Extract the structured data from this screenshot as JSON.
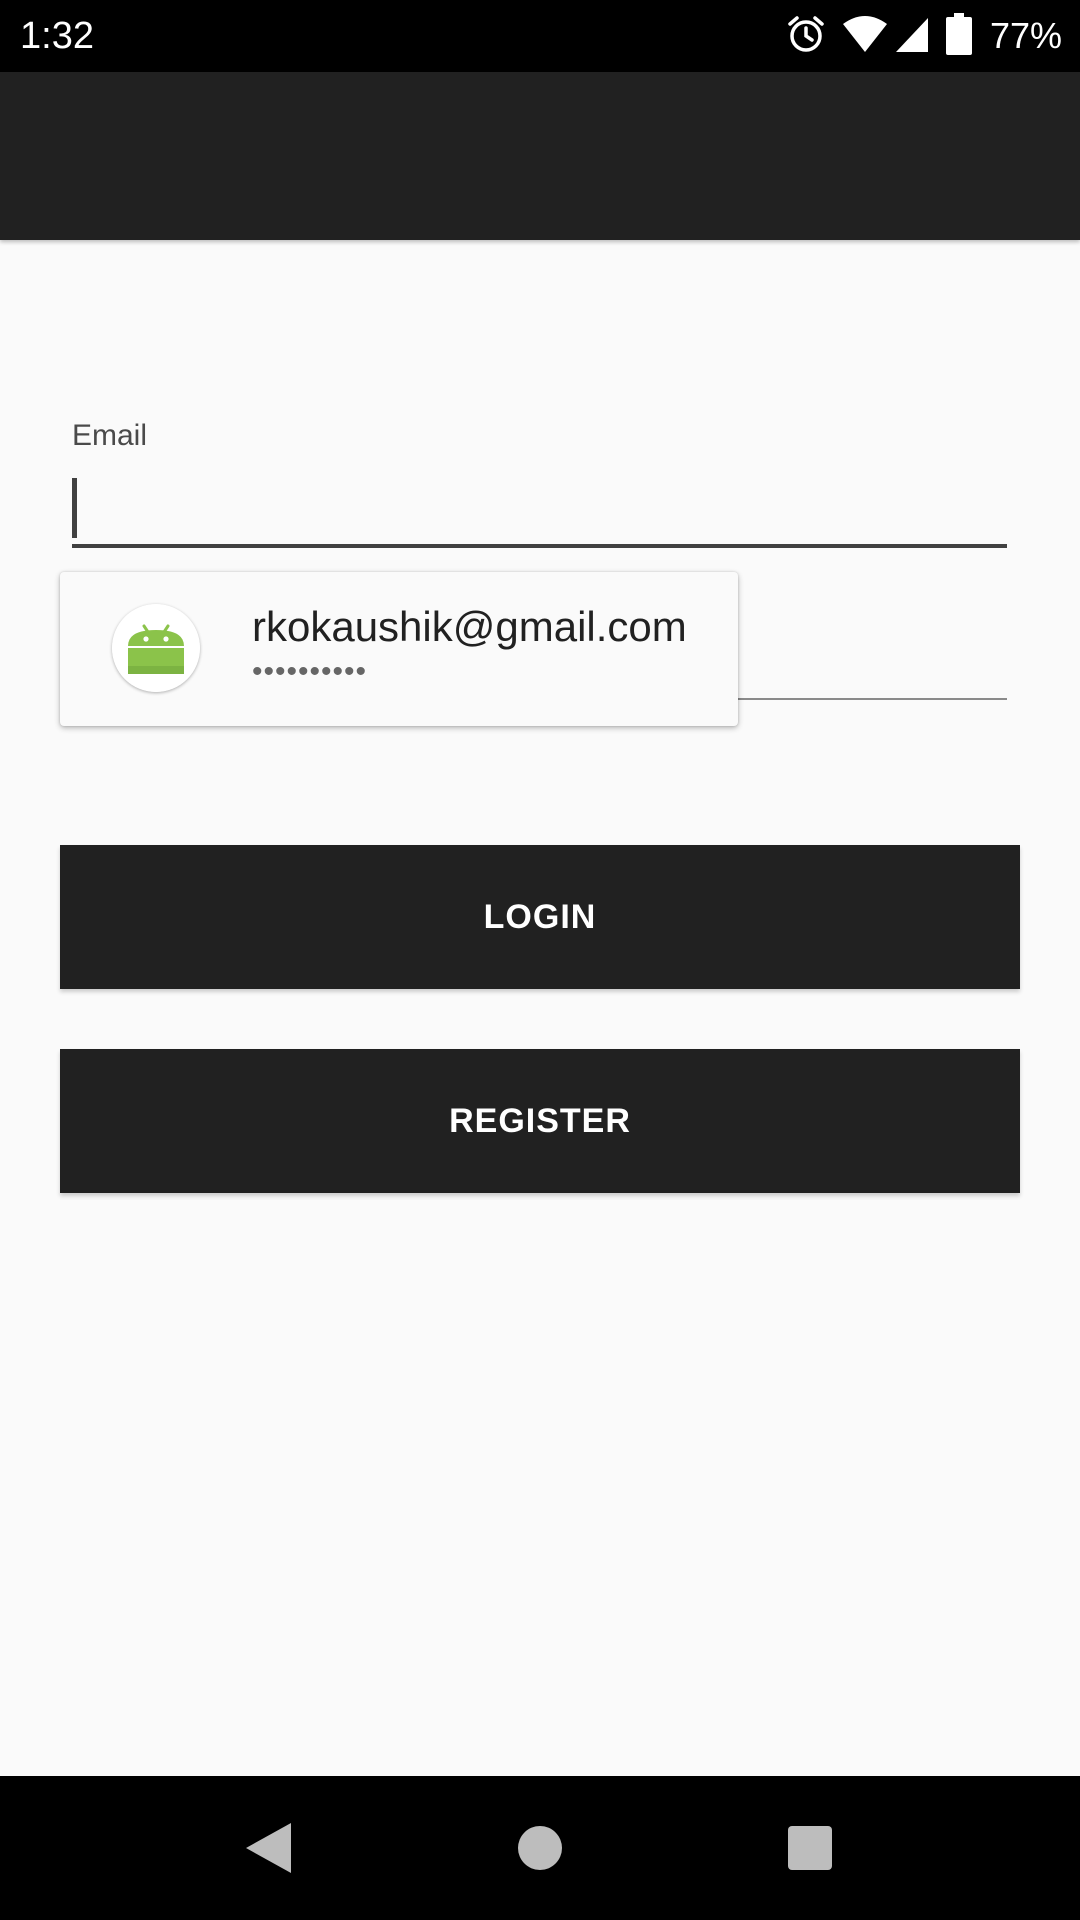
{
  "status_bar": {
    "time": "1:32",
    "battery_percent": "77%",
    "icons": [
      "alarm-icon",
      "wifi-icon",
      "cell-signal-icon",
      "battery-icon"
    ]
  },
  "app_bar": {
    "color": "#212121"
  },
  "login_form": {
    "email_label": "Email",
    "email_value": "",
    "password_value": ""
  },
  "autofill": {
    "account_email": "rkokaushik@gmail.com",
    "masked_password": "••••••••••",
    "app_icon": "android-icon"
  },
  "buttons": {
    "login": "LOGIN",
    "register": "REGISTER"
  },
  "nav_bar": {
    "icons": [
      "back-icon",
      "home-icon",
      "recents-icon"
    ]
  },
  "colors": {
    "primary_dark": "#212121",
    "background": "#fafafa",
    "android_green": "#8bc34a"
  }
}
